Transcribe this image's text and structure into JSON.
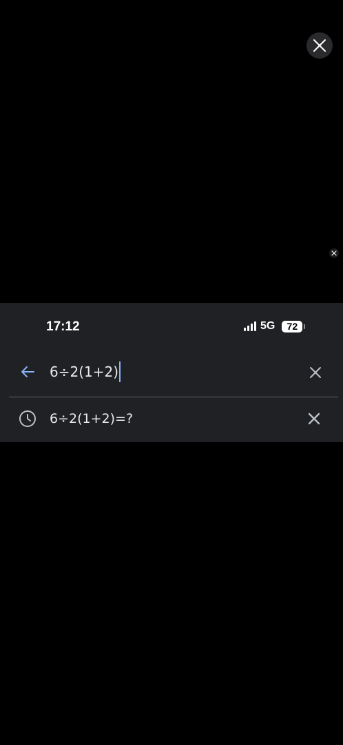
{
  "overlay": {
    "close_icon": "close-icon",
    "small_close_icon": "close-icon"
  },
  "status_bar": {
    "time": "17:12",
    "network": "5G",
    "battery": "72",
    "signal_icon": "cellular-signal-icon",
    "battery_icon": "battery-icon"
  },
  "search": {
    "back_icon": "arrow-left-icon",
    "query": "6÷2(1+2)",
    "clear_icon": "close-icon"
  },
  "suggestions": [
    {
      "icon": "history-clock-icon",
      "text": "6÷2(1+2)=?",
      "remove_icon": "close-icon"
    }
  ],
  "colors": {
    "background": "#000000",
    "panel": "#202124",
    "text": "#e8eaed",
    "accent": "#8ab4f8",
    "icon_gray": "#bdc1c6"
  }
}
